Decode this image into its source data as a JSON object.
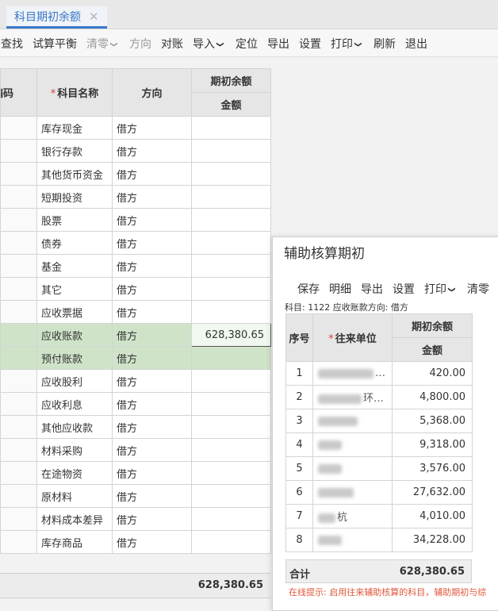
{
  "tab": {
    "label": "科目期初余额",
    "close": "✕"
  },
  "toolbar": {
    "find": "查找",
    "trial_balance": "试算平衡",
    "clear_zero": "清零",
    "direction": "方向",
    "reconcile": "对账",
    "import": "导入",
    "locate": "定位",
    "export": "导出",
    "settings": "设置",
    "print": "打印",
    "refresh": "刷新",
    "exit": "退出"
  },
  "main_table": {
    "headers": {
      "code": "编码",
      "name": "科目名称",
      "direction": "方向",
      "opening": "期初余额",
      "amount": "金额"
    },
    "rows": [
      {
        "name": "库存现金",
        "direction": "借方",
        "amount": ""
      },
      {
        "name": "银行存款",
        "direction": "借方",
        "amount": ""
      },
      {
        "name": "其他货币资金",
        "direction": "借方",
        "amount": ""
      },
      {
        "name": "短期投资",
        "direction": "借方",
        "amount": ""
      },
      {
        "name": "股票",
        "direction": "借方",
        "amount": ""
      },
      {
        "name": "债券",
        "direction": "借方",
        "amount": ""
      },
      {
        "name": "基金",
        "direction": "借方",
        "amount": ""
      },
      {
        "name": "其它",
        "direction": "借方",
        "amount": ""
      },
      {
        "name": "应收票据",
        "direction": "借方",
        "amount": ""
      },
      {
        "name": "应收账款",
        "direction": "借方",
        "amount": "628,380.65"
      },
      {
        "name": "预付账款",
        "direction": "借方",
        "amount": ""
      },
      {
        "name": "应收股利",
        "direction": "借方",
        "amount": ""
      },
      {
        "name": "应收利息",
        "direction": "借方",
        "amount": ""
      },
      {
        "name": "其他应收款",
        "direction": "借方",
        "amount": ""
      },
      {
        "name": "材料采购",
        "direction": "借方",
        "amount": ""
      },
      {
        "name": "在途物资",
        "direction": "借方",
        "amount": ""
      },
      {
        "name": "原材料",
        "direction": "借方",
        "amount": ""
      },
      {
        "name": "材料成本差异",
        "direction": "借方",
        "amount": ""
      },
      {
        "name": "库存商品",
        "direction": "借方",
        "amount": ""
      }
    ],
    "total": "628,380.65"
  },
  "dialog": {
    "title": "辅助核算期初",
    "toolbar": {
      "save": "保存",
      "detail": "明细",
      "export": "导出",
      "settings": "设置",
      "print": "打印",
      "clear_zero": "清零"
    },
    "info": "科目: 1122 应收账款方向: 借方",
    "headers": {
      "no": "序号",
      "unit": "往来单位",
      "opening": "期初余额",
      "amount": "金额"
    },
    "rows": [
      {
        "no": "1",
        "unit": "…",
        "amount": "420.00"
      },
      {
        "no": "2",
        "unit": "环…",
        "amount": "4,800.00"
      },
      {
        "no": "3",
        "unit": "",
        "amount": "5,368.00"
      },
      {
        "no": "4",
        "unit": "",
        "amount": "9,318.00"
      },
      {
        "no": "5",
        "unit": "",
        "amount": "3,576.00"
      },
      {
        "no": "6",
        "unit": "",
        "amount": "27,632.00"
      },
      {
        "no": "7",
        "unit": "杭",
        "amount": "4,010.00"
      },
      {
        "no": "8",
        "unit": "",
        "amount": "34,228.00"
      }
    ],
    "total_label": "合计",
    "total": "628,380.65",
    "hint": "在线提示: 启用往来辅助核算的科目，辅助期初与综"
  },
  "colors": {
    "accent": "#3a78c9",
    "selected_row": "#cfe3c9",
    "hint": "#e0553a"
  }
}
